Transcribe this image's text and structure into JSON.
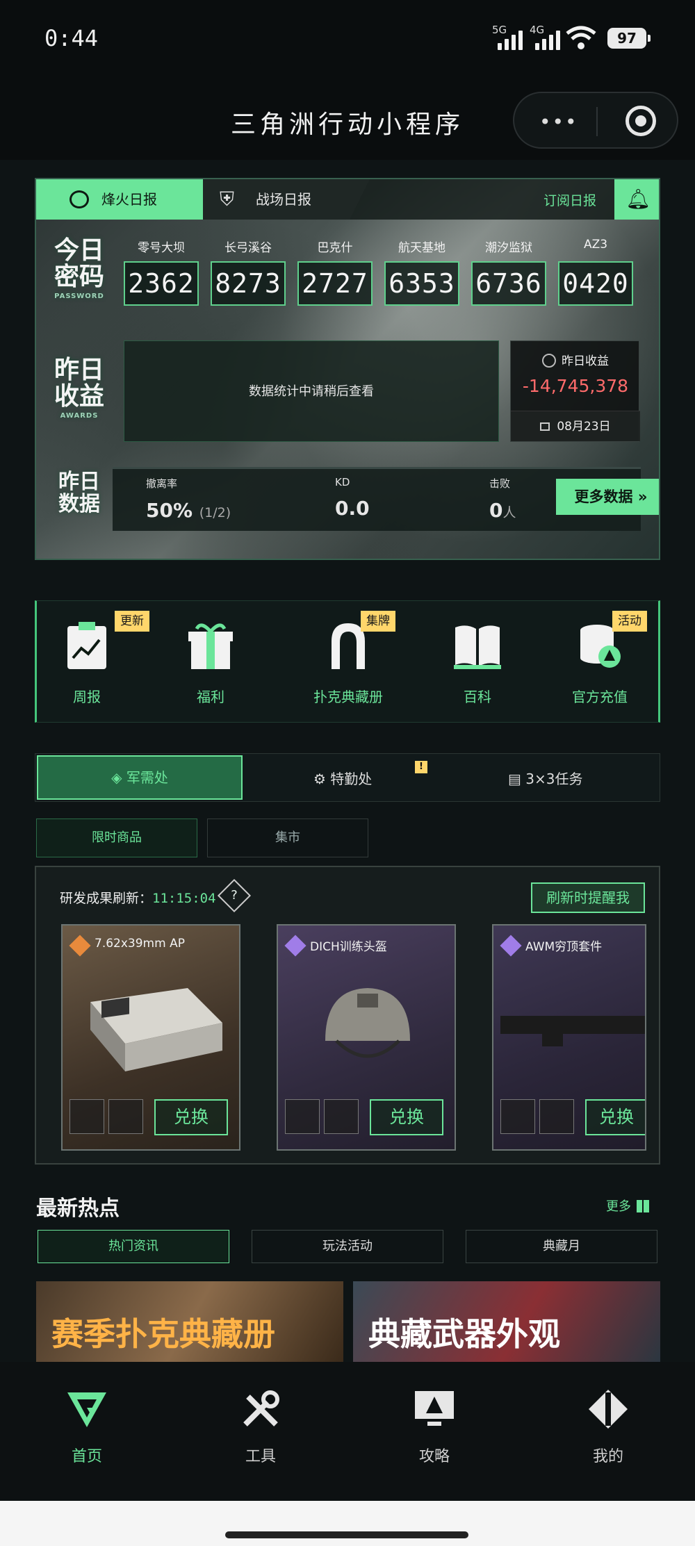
{
  "status": {
    "time": "0:44",
    "sig1": "5G",
    "sig2": "4G",
    "battery": "97"
  },
  "app": {
    "title": "三角洲行动小程序",
    "more": "•••"
  },
  "daily": {
    "tabs": [
      "烽火日报",
      "战场日报"
    ],
    "subscribe": "订阅日报",
    "password_label": "今日\n密码",
    "password_label_en": "PASSWORD",
    "passwords": [
      {
        "map": "零号大坝",
        "code": "2362"
      },
      {
        "map": "长弓溪谷",
        "code": "8273"
      },
      {
        "map": "巴克什",
        "code": "2727"
      },
      {
        "map": "航天基地",
        "code": "6353"
      },
      {
        "map": "潮汐监狱",
        "code": "6736"
      },
      {
        "map": "AZ3",
        "code": "0420"
      }
    ],
    "earnings_label": "昨日\n收益",
    "earnings_label_en": "AWARDS",
    "stats_placeholder": "数据统计中请稍后查看",
    "earnings_title": "昨日收益",
    "earnings_value": "-14,745,378",
    "earnings_date": "08月23日",
    "data_label": "昨日\n数据",
    "evac_label": "撤离率",
    "evac_value": "50%",
    "evac_detail": "(1/2)",
    "kd_label": "KD",
    "kd_value": "0.0",
    "team_label": "击败",
    "team_value": "0",
    "team_unit": "人",
    "more_button": "更多数据"
  },
  "menu": [
    {
      "label": "周报",
      "badge": "更新"
    },
    {
      "label": "福利",
      "badge": ""
    },
    {
      "label": "扑克典藏册",
      "badge": "集牌"
    },
    {
      "label": "百科",
      "badge": ""
    },
    {
      "label": "官方充值",
      "badge": "活动"
    }
  ],
  "segments": {
    "s1": "军需处",
    "s2": "特勤处",
    "s3": "3×3任务",
    "warn": "!"
  },
  "subtabs": [
    "限时商品",
    "集市"
  ],
  "shop": {
    "refresh_label": "研发成果刷新：",
    "refresh_time": "11:15:04",
    "q": "?",
    "remind": "刷新时提醒我",
    "exchange": "兑换",
    "items": [
      {
        "name": "7.62x39mm AP",
        "rarity_color": "#e88a3c"
      },
      {
        "name": "DICH训练头盔",
        "rarity_color": "#a07de8"
      },
      {
        "name": "AWM穷顶套件",
        "rarity_color": "#a07de8"
      }
    ]
  },
  "hot": {
    "title": "最新热点",
    "more": "更多",
    "tabs": [
      "热门资讯",
      "玩法活动",
      "典藏月"
    ],
    "banners": [
      "赛季扑克典藏册",
      "典藏武器外观"
    ]
  },
  "nav": [
    "首页",
    "工具",
    "攻略",
    "我的"
  ]
}
